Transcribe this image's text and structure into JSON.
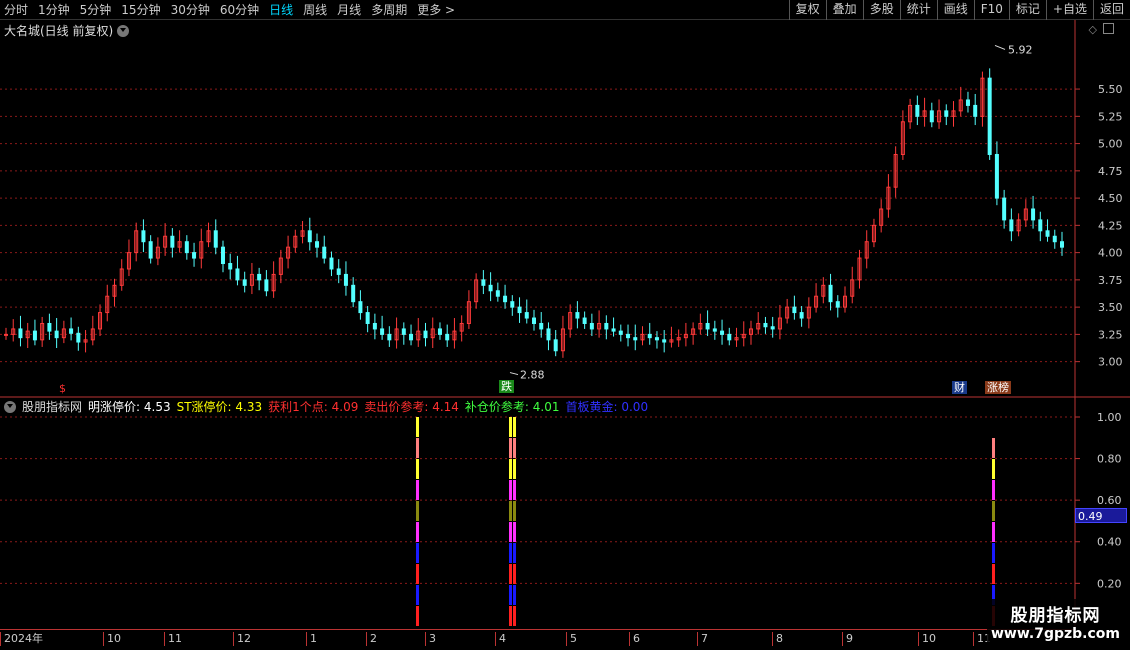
{
  "toolbar": {
    "periods": [
      "分时",
      "1分钟",
      "5分钟",
      "15分钟",
      "30分钟",
      "60分钟",
      "日线",
      "周线",
      "月线",
      "多周期",
      "更多 >"
    ],
    "active_period": "日线",
    "actions": [
      "复权",
      "叠加",
      "多股",
      "统计",
      "画线",
      "F10",
      "标记",
      "+自选",
      "返回"
    ]
  },
  "stock": {
    "title": "大名城(日线 前复权)"
  },
  "price_axis": {
    "ticks": [
      "5.50",
      "5.25",
      "5.00",
      "4.75",
      "4.50",
      "4.25",
      "4.00",
      "3.75",
      "3.50",
      "3.25",
      "3.00"
    ]
  },
  "annotations": {
    "high": "5.92",
    "low": "2.88"
  },
  "signals": {
    "s": "$",
    "die": "跌",
    "cai": "财",
    "zhang": "涨榜"
  },
  "indicator": {
    "name": "股朋指标网",
    "items": [
      {
        "label": "明涨停价: ",
        "value": "4.53",
        "color": "#ffffff"
      },
      {
        "label": "ST涨停价: ",
        "value": "4.33",
        "color": "#ffff00"
      },
      {
        "label": "获利1个点: ",
        "value": "4.09",
        "color": "#ff3030"
      },
      {
        "label": "卖出价参考: ",
        "value": "4.14",
        "color": "#ff3030"
      },
      {
        "label": "补仓价参考: ",
        "value": "4.01",
        "color": "#40ff40"
      },
      {
        "label": "首板黄金: ",
        "value": "0.00",
        "color": "#3030ff"
      }
    ],
    "axis_ticks": [
      "1.00",
      "0.80",
      "0.60",
      "0.40",
      "0.20"
    ],
    "current_value": "0.49"
  },
  "date_axis": [
    "2024年",
    "10",
    "11",
    "12",
    "1",
    "2",
    "3",
    "4",
    "5",
    "6",
    "7",
    "8",
    "9",
    "10",
    "11"
  ],
  "watermark": {
    "line1": "股朋指标网",
    "line2": "www.7gpzb.com"
  },
  "colors": {
    "up": "#ff3a3a",
    "down": "#54ffff",
    "grid": "#8a1a1a",
    "bg": "#000000"
  },
  "chart_data": {
    "type": "candlestick",
    "price_range": [
      2.85,
      5.95
    ],
    "closes": [
      3.25,
      3.3,
      3.22,
      3.28,
      3.2,
      3.35,
      3.28,
      3.22,
      3.3,
      3.26,
      3.18,
      3.2,
      3.3,
      3.45,
      3.6,
      3.7,
      3.85,
      4.0,
      4.2,
      4.1,
      3.95,
      4.05,
      4.15,
      4.05,
      4.1,
      4.0,
      3.95,
      4.1,
      4.2,
      4.05,
      3.9,
      3.85,
      3.75,
      3.7,
      3.8,
      3.75,
      3.65,
      3.8,
      3.95,
      4.05,
      4.15,
      4.2,
      4.1,
      4.05,
      3.95,
      3.85,
      3.8,
      3.7,
      3.55,
      3.45,
      3.35,
      3.3,
      3.25,
      3.2,
      3.3,
      3.25,
      3.2,
      3.28,
      3.22,
      3.3,
      3.25,
      3.2,
      3.28,
      3.35,
      3.55,
      3.75,
      3.7,
      3.65,
      3.6,
      3.55,
      3.5,
      3.45,
      3.4,
      3.35,
      3.3,
      3.2,
      3.1,
      3.3,
      3.45,
      3.4,
      3.35,
      3.3,
      3.35,
      3.3,
      3.28,
      3.25,
      3.22,
      3.2,
      3.25,
      3.22,
      3.2,
      3.18,
      3.2,
      3.22,
      3.25,
      3.3,
      3.35,
      3.3,
      3.28,
      3.25,
      3.2,
      3.22,
      3.25,
      3.3,
      3.35,
      3.32,
      3.3,
      3.4,
      3.5,
      3.45,
      3.4,
      3.5,
      3.6,
      3.7,
      3.55,
      3.5,
      3.6,
      3.75,
      3.95,
      4.1,
      4.25,
      4.4,
      4.6,
      4.9,
      5.2,
      5.35,
      5.25,
      5.3,
      5.2,
      5.3,
      5.25,
      5.3,
      5.4,
      5.35,
      5.25,
      5.6,
      4.9,
      4.5,
      4.3,
      4.2,
      4.3,
      4.4,
      4.3,
      4.2,
      4.15,
      4.1,
      4.05
    ]
  }
}
